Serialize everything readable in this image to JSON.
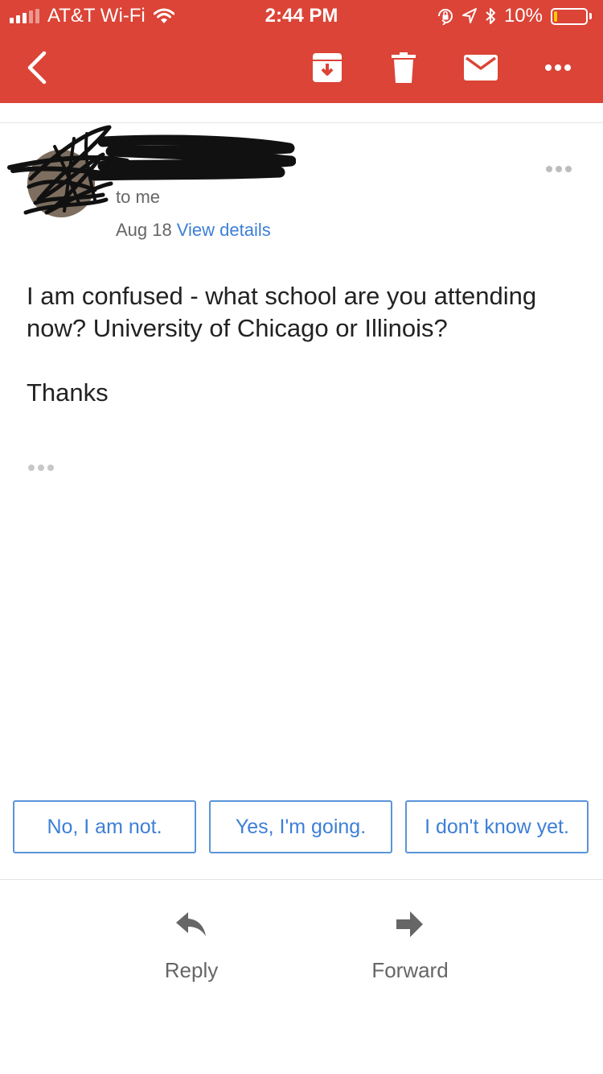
{
  "status_bar": {
    "carrier": "AT&T Wi-Fi",
    "time": "2:44 PM",
    "battery": "10%",
    "battery_level": 0.1,
    "icons": [
      "signal-icon",
      "wifi-icon",
      "orientation-lock-icon",
      "location-icon",
      "bluetooth-icon",
      "battery-icon"
    ]
  },
  "toolbar": {
    "back": "back-icon",
    "actions": [
      "archive-icon",
      "trash-icon",
      "mail-icon",
      "more-icon"
    ]
  },
  "email": {
    "recipient": "to me",
    "date": "Aug 18",
    "view_details": "View details",
    "body": [
      "I am confused - what school are you attending now? University of Chicago or Illinois?",
      "Thanks"
    ]
  },
  "smart_replies": [
    "No, I am not.",
    "Yes, I'm going.",
    "I don't know yet."
  ],
  "actions": {
    "reply": "Reply",
    "forward": "Forward"
  },
  "colors": {
    "app_bar": "#db4437",
    "link": "#3d7fd6",
    "battery_fill": "#ffcc00"
  }
}
